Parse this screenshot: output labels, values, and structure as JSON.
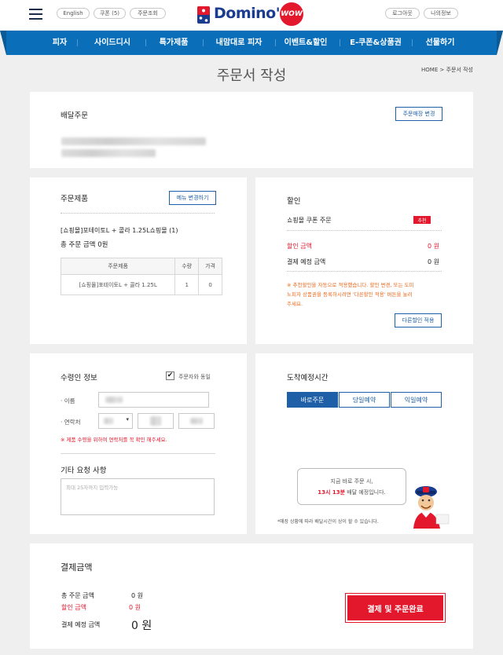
{
  "header": {
    "lang_label": "English",
    "coupon_label": "쿠폰 (5)",
    "order_lookup_label": "주문조회",
    "logo_text": "Domino's",
    "logo_badge": "WOW",
    "logout_label": "로그아웃",
    "myinfo_label": "나의정보"
  },
  "nav": {
    "items": [
      "피자",
      "사이드디시",
      "특가제품",
      "내맘대로 피자",
      "이벤트&할인",
      "E-쿠폰&상품권",
      "선물하기"
    ]
  },
  "page": {
    "title": "주문서 작성",
    "breadcrumb": "HOME > 주문서 작성"
  },
  "delivery": {
    "title": "배달주문",
    "change_store_label": "주문매장 변경"
  },
  "order_items": {
    "title": "주문제품",
    "change_menu_label": "메뉴 변경하기",
    "item_line": "[쇼핑몰]포테이토L + 콜라 1.25L쇼핑몰 (1)",
    "total_line": "총 주문 금액 0원",
    "table": {
      "headers": [
        "주문제품",
        "수량",
        "가격"
      ],
      "rows": [
        [
          "[쇼핑몰]포테이토L + 콜라 1.25L",
          "1",
          "0"
        ]
      ]
    }
  },
  "discount": {
    "title": "할인",
    "coupon_label": "쇼핑몰 쿠폰 주문",
    "badge": "추천",
    "discount_label": "할인 금액",
    "discount_value": "0 원",
    "expected_label": "결제 예정 금액",
    "expected_value": "0 원",
    "notice": [
      "※ 추천할인을 자동으로 적용했습니다. 할인 변경, 또는 도미",
      "노피자 상품권을 등록하시려면 '다른할인 적용' 버튼을 눌러",
      "주세요."
    ],
    "other_discount_label": "다른할인 적용"
  },
  "recipient": {
    "title": "수령인 정보",
    "same_as_orderer_label": "주문자와 동일",
    "same_as_orderer_checked": "✔",
    "name_label": "· 이름",
    "phone_label": "· 연락처",
    "phone_select_caret": "▾",
    "phone_notice": "※ 제품 수령을 위하여 연락처를 꼭 확인 해주세요.",
    "request_title": "기타 요청 사항",
    "request_placeholder": "최대 25자까지 입력가능"
  },
  "arrival": {
    "title": "도착예정시간",
    "options": [
      "바로주문",
      "당일예약",
      "익일예약"
    ],
    "bubble_line1": "지금 바로 주문 시,",
    "bubble_time": "13시 13분",
    "bubble_line2_rest": " 배달 예정입니다.",
    "note": "*매장 상황에 따라 배달시간이 상이 할 수 있습니다."
  },
  "payment": {
    "title": "결제금액",
    "total_label": "총 주문 금액",
    "total_value": "0 원",
    "discount_label": "할인 금액",
    "discount_value": "0 원",
    "expected_label": "결제 예정 금액",
    "expected_value": "0 원",
    "pay_button_label": "결제 및 주문완료"
  },
  "colors": {
    "brand_blue": "#0a6eb8",
    "accent_red": "#e3182d",
    "button_blue": "#1e5fa8"
  }
}
